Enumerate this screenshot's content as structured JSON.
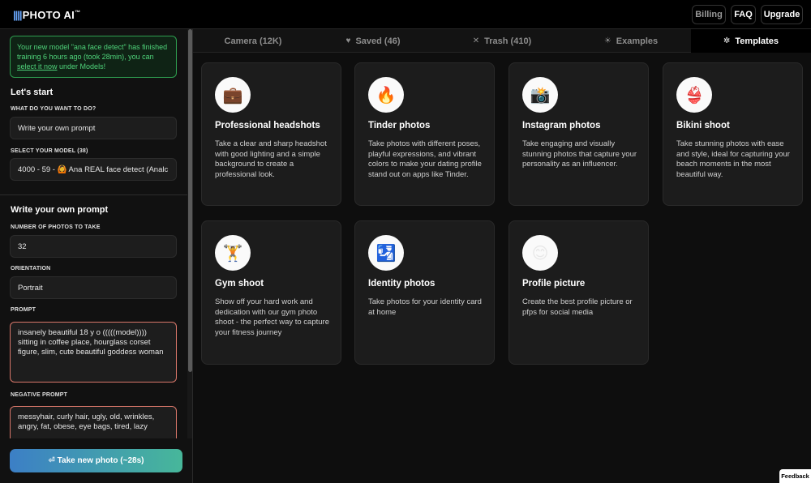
{
  "header": {
    "logo_bars": "||||",
    "logo_text": "PHOTO AI",
    "logo_tm": "™",
    "billing_label": "Billing",
    "faq_label": "FAQ",
    "upgrade_label": "Upgrade"
  },
  "sidebar": {
    "notice": {
      "line_part1": "Your new model \"ana face detect\" has finished training 6 hours ago (took 28min), you can ",
      "link": "select it now",
      "line_part2": " under Models!"
    },
    "lets_start_heading": "Let's start",
    "what_label": "WHAT DO YOU WANT TO DO?",
    "what_value": "Write your own prompt",
    "model_label": "SELECT YOUR MODEL (38)",
    "model_value": "4000 - 59 - 🙆 Ana REAL face detect (Analc",
    "prompt_heading": "Write your own prompt",
    "num_label": "NUMBER OF PHOTOS TO TAKE",
    "num_value": "32",
    "orientation_label": "ORIENTATION",
    "orientation_value": "Portrait",
    "prompt_label": "PROMPT",
    "prompt_value": "insanely beautiful 18 y o (((((model)))) sitting in coffee place, hourglass corset figure, slim, cute beautiful goddess woman",
    "negative_label": "NEGATIVE PROMPT",
    "negative_value": "messyhair, curly hair, ugly, old, wrinkles, angry, fat, obese, eye bags, tired, lazy",
    "take_button": "⏎ Take new photo (~28s)"
  },
  "tabs": [
    {
      "label": "Camera (12K)",
      "icon": ""
    },
    {
      "label": "Saved (46)",
      "icon": "♥"
    },
    {
      "label": "Trash (410)",
      "icon": "✕"
    },
    {
      "label": "Examples",
      "icon": "☀"
    },
    {
      "label": "Templates",
      "icon": "✲"
    }
  ],
  "templates": [
    {
      "icon": "💼",
      "icon_name": "briefcase-icon",
      "title": "Professional headshots",
      "desc": "Take a clear and sharp headshot with good lighting and a simple background to create a professional look."
    },
    {
      "icon": "🔥",
      "icon_name": "fire-icon",
      "title": "Tinder photos",
      "desc": "Take photos with different poses, playful expressions, and vibrant colors to make your dating profile stand out on apps like Tinder."
    },
    {
      "icon": "📸",
      "icon_name": "camera-flash-icon",
      "title": "Instagram photos",
      "desc": "Take engaging and visually stunning photos that capture your personality as an influencer."
    },
    {
      "icon": "👙",
      "icon_name": "bikini-icon",
      "title": "Bikini shoot",
      "desc": "Take stunning photos with ease and style, ideal for capturing your beach moments in the most beautiful way."
    },
    {
      "icon": "🏋",
      "icon_name": "weightlifter-icon",
      "title": "Gym shoot",
      "desc": "Show off your hard work and dedication with our gym photo shoot - the perfect way to capture your fitness journey"
    },
    {
      "icon": "🛂",
      "icon_name": "passport-control-icon",
      "title": "Identity photos",
      "desc": "Take photos for your identity card at home"
    },
    {
      "icon": "😊",
      "icon_name": "smiley-icon",
      "title": "Profile picture",
      "desc": "Create the best profile picture or pfps for social media"
    }
  ],
  "feedback_label": "Feedback",
  "colors": {
    "notice_green": "#4fd37a",
    "textarea_border": "#d9776a",
    "button_gradient_start": "#3c7fc6",
    "button_gradient_end": "#47b79a"
  }
}
